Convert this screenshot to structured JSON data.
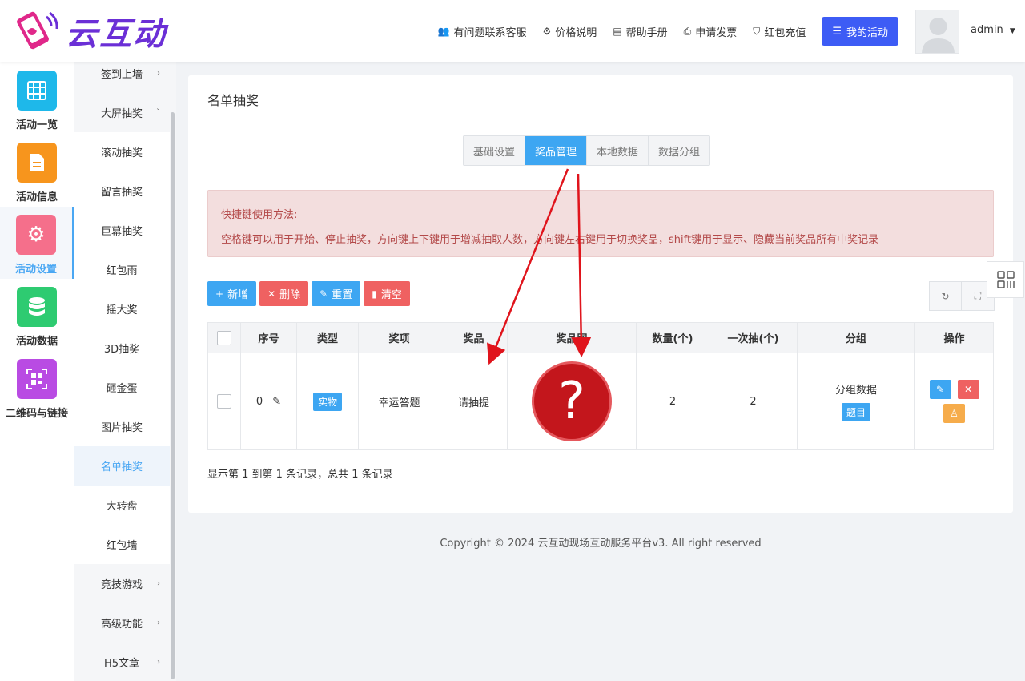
{
  "header": {
    "logo_text": "云互动",
    "nav": [
      {
        "icon": "customer-service-icon",
        "label": "有问题联系客服"
      },
      {
        "icon": "price-icon",
        "label": "价格说明"
      },
      {
        "icon": "book-icon",
        "label": "帮助手册"
      },
      {
        "icon": "printer-icon",
        "label": "申请发票"
      },
      {
        "icon": "shield-icon",
        "label": "红包充值"
      }
    ],
    "my_activity": "我的活动",
    "username": "admin"
  },
  "rail": [
    {
      "label": "活动一览",
      "icon": "grid-icon",
      "color": "#1eb8ea"
    },
    {
      "label": "活动信息",
      "icon": "document-icon",
      "color": "#f7951d"
    },
    {
      "label": "活动设置",
      "icon": "gear-icon",
      "color": "#f56f8b",
      "active": true
    },
    {
      "label": "活动数据",
      "icon": "database-icon",
      "color": "#2ecb71"
    },
    {
      "label": "二维码与链接",
      "icon": "qrcode-icon",
      "color": "#b94be3"
    }
  ],
  "submenu": {
    "items": [
      {
        "label": "签到上墙",
        "arrow": "›"
      },
      {
        "label": "大屏抽奖",
        "arrow": "ˇ"
      },
      {
        "label": "滚动抽奖"
      },
      {
        "label": "留言抽奖"
      },
      {
        "label": "巨幕抽奖"
      },
      {
        "label": "红包雨"
      },
      {
        "label": "摇大奖"
      },
      {
        "label": "3D抽奖"
      },
      {
        "label": "砸金蛋"
      },
      {
        "label": "图片抽奖"
      },
      {
        "label": "名单抽奖",
        "active": true
      },
      {
        "label": "大转盘"
      },
      {
        "label": "红包墙"
      },
      {
        "label": "竞技游戏",
        "arrow": "›"
      },
      {
        "label": "高级功能",
        "arrow": "›"
      },
      {
        "label": "H5文章",
        "arrow": "›"
      }
    ]
  },
  "panel": {
    "title": "名单抽奖",
    "tabs": [
      "基础设置",
      "奖品管理",
      "本地数据",
      "数据分组"
    ],
    "active_tab": "奖品管理",
    "alert_title": "快捷键使用方法:",
    "alert_body": "空格键可以用于开始、停止抽奖，方向键上下键用于增减抽取人数，方向键左右键用于切换奖品，shift键用于显示、隐藏当前奖品所有中奖记录",
    "toolbar": {
      "add": "新增",
      "delete": "删除",
      "reset": "重置",
      "clear": "清空"
    },
    "table": {
      "headers": [
        "序号",
        "类型",
        "奖项",
        "奖品",
        "奖品图",
        "数量(个)",
        "一次抽(个)",
        "分组",
        "操作"
      ],
      "rows": [
        {
          "index": "0",
          "type": "实物",
          "award": "幸运答题",
          "prize": "请抽提",
          "image_glyph": "?",
          "quantity": "2",
          "per_draw": "2",
          "group": "分组数据",
          "group_tag": "题目"
        }
      ]
    },
    "pager": "显示第 1 到第 1 条记录，总共 1 条记录"
  },
  "footer": "Copyright © 2024 云互动现场互动服务平台v3. All right reserved",
  "colors": {
    "primary": "#3da6f2",
    "danger": "#ef6161",
    "warning": "#f6ac4b",
    "accent": "#3d5cf5",
    "annotation_arrow": "#e0141c"
  }
}
